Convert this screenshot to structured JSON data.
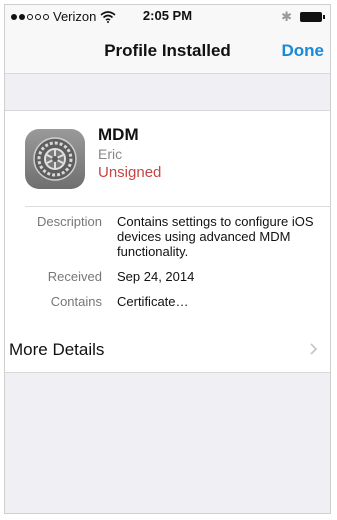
{
  "status_bar": {
    "carrier": "Verizon",
    "time": "2:05 PM",
    "signal_bars_filled": 2,
    "signal_bars_total": 5
  },
  "nav": {
    "title": "Profile Installed",
    "done_label": "Done"
  },
  "profile": {
    "name": "MDM",
    "organization": "Eric",
    "status": "Unsigned",
    "status_color": "#c64545",
    "icon": "settings-gear-icon"
  },
  "details": [
    {
      "label": "Description",
      "value": "Contains settings to configure iOS devices using advanced MDM functionality."
    },
    {
      "label": "Received",
      "value": "Sep 24, 2014"
    },
    {
      "label": "Contains",
      "value": "Certificate…"
    }
  ],
  "more_details": {
    "label": "More Details",
    "icon": "chevron-right-icon"
  },
  "colors": {
    "accent": "#1a8ad8",
    "background": "#f0eff4"
  }
}
